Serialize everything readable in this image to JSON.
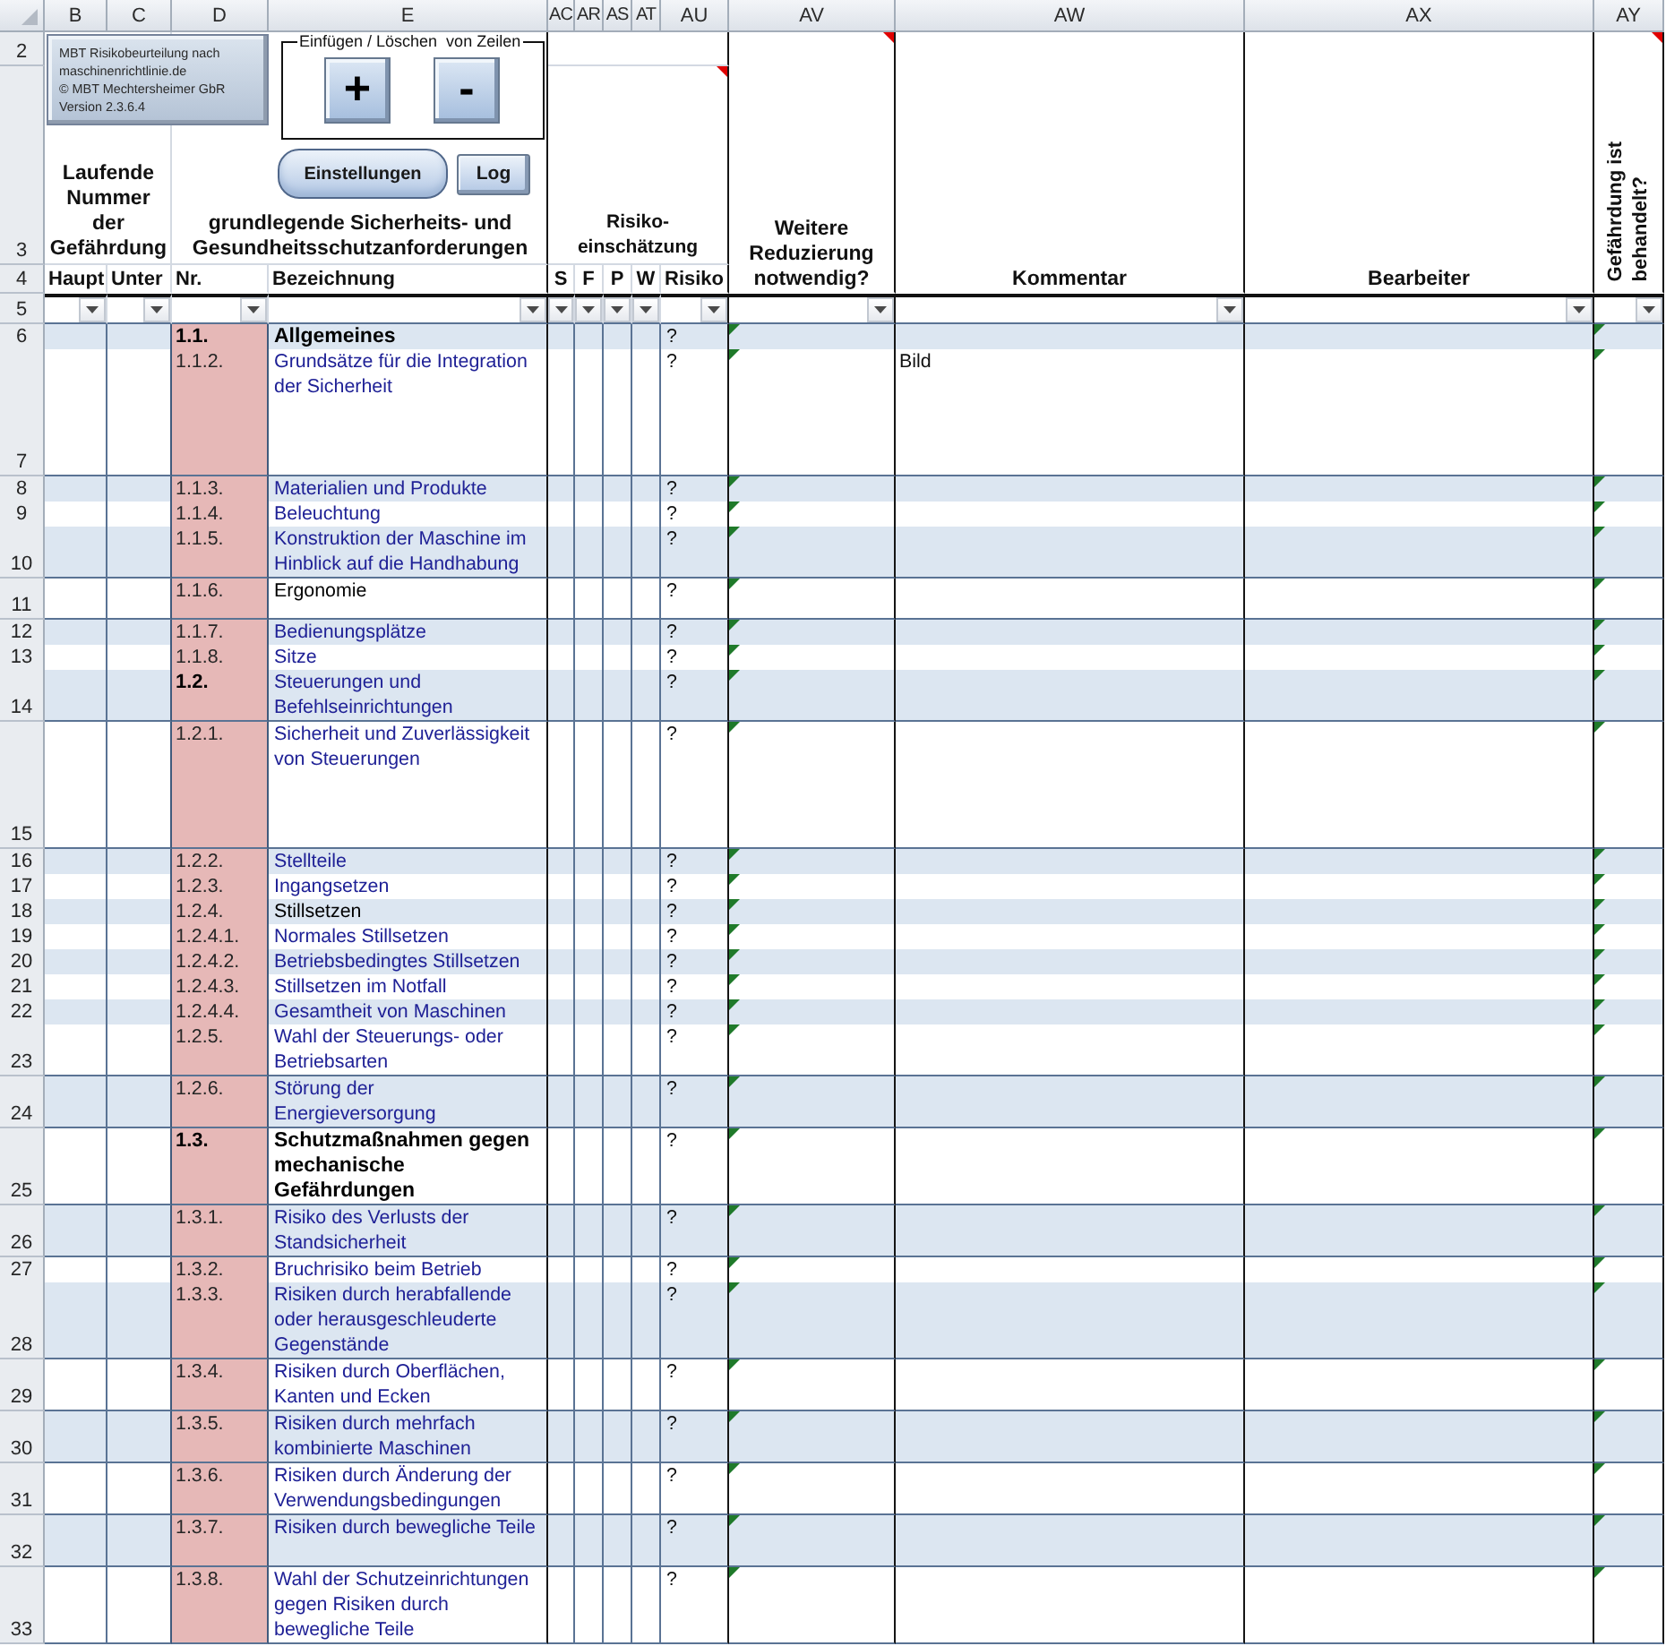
{
  "columns": [
    {
      "letter": "B",
      "filter": true
    },
    {
      "letter": "C",
      "filter": true
    },
    {
      "letter": "D",
      "filter": true
    },
    {
      "letter": "E",
      "filter": true
    },
    {
      "letter": "AC",
      "filter": true
    },
    {
      "letter": "AR",
      "filter": true
    },
    {
      "letter": "AS",
      "filter": true
    },
    {
      "letter": "AT",
      "filter": true
    },
    {
      "letter": "AU",
      "filter": true
    },
    {
      "letter": "AV",
      "filter": true
    },
    {
      "letter": "AW",
      "filter": true
    },
    {
      "letter": "AX",
      "filter": true
    },
    {
      "letter": "AY",
      "filter": true
    }
  ],
  "header_rows": [
    "2",
    "3",
    "4",
    "5"
  ],
  "info_box": {
    "text": "MBT Risikobeurteilung nach\nmaschinenrichtlinie.de\n© MBT Mechtersheimer GbR\nVersion 2.3.6.4"
  },
  "row_tools": {
    "label": "Einfügen / Löschen  von Zeilen",
    "buttons": [
      "+",
      "-"
    ]
  },
  "buttons": [
    {
      "label": "Einstellungen",
      "kind": "rounded"
    },
    {
      "label": "Log",
      "kind": "square"
    }
  ],
  "headings": {
    "hazard_number": {
      "text": "Laufende\nNummer\nder\nGefährdung"
    },
    "requirements": {
      "text": "grundlegende Sicherheits- und\nGesundheitsschutzanforderungen"
    },
    "risk_assessment": {
      "text": "Risiko-\neinschätzung",
      "comment": true
    },
    "further_reduction": {
      "text": "Weitere\nReduzierung\nnotwendig?",
      "comment": true
    },
    "remarks": {
      "text": "Kommentar"
    },
    "editor": {
      "text": "Bearbeiter"
    },
    "handled": {
      "text": "Gefährdung ist\nbehandelt?",
      "comment": true
    }
  },
  "subheadings": [
    "Haupt",
    "Unter",
    "Nr.",
    "Bezeichnung",
    "S",
    "F",
    "P",
    "W",
    "Risiko"
  ],
  "rows": [
    {
      "row": "6",
      "nr": "1.1.",
      "title": "Allgemeines",
      "kind": "section",
      "bold": true,
      "link": false,
      "risk": "?",
      "error_indicator": true
    },
    {
      "row": "7",
      "nr": "1.1.2.",
      "title": "Grundsätze für die Integration\nder Sicherheit",
      "kind": "item",
      "bold": false,
      "link": true,
      "risk": "?",
      "comment": "Bild",
      "error_indicator": true
    },
    {
      "row": "8",
      "nr": "1.1.3.",
      "title": "Materialien und Produkte",
      "kind": "item",
      "bold": false,
      "link": true,
      "risk": "?",
      "error_indicator": true
    },
    {
      "row": "9",
      "nr": "1.1.4.",
      "title": "Beleuchtung",
      "kind": "item",
      "bold": false,
      "link": true,
      "risk": "?",
      "error_indicator": true
    },
    {
      "row": "10",
      "nr": "1.1.5.",
      "title": "Konstruktion der Maschine im\nHinblick auf die Handhabung",
      "kind": "item",
      "bold": false,
      "link": true,
      "risk": "?",
      "error_indicator": true
    },
    {
      "row": "11",
      "nr": "1.1.6.",
      "title": "Ergonomie",
      "kind": "item",
      "bold": false,
      "link": false,
      "risk": "?",
      "error_indicator": true
    },
    {
      "row": "12",
      "nr": "1.1.7.",
      "title": "Bedienungsplätze",
      "kind": "item",
      "bold": false,
      "link": true,
      "risk": "?",
      "error_indicator": true
    },
    {
      "row": "13",
      "nr": "1.1.8.",
      "title": "Sitze",
      "kind": "item",
      "bold": false,
      "link": true,
      "risk": "?",
      "error_indicator": true
    },
    {
      "row": "14",
      "nr": "1.2.",
      "title": "Steuerungen und\nBefehlseinrichtungen",
      "kind": "section",
      "bold": false,
      "link": true,
      "risk": "?",
      "error_indicator": true
    },
    {
      "row": "15",
      "nr": "1.2.1.",
      "title": "Sicherheit und Zuverlässigkeit\nvon Steuerungen",
      "kind": "item",
      "bold": false,
      "link": true,
      "risk": "?",
      "error_indicator": true
    },
    {
      "row": "16",
      "nr": "1.2.2.",
      "title": "Stellteile",
      "kind": "item",
      "bold": false,
      "link": true,
      "risk": "?",
      "error_indicator": true
    },
    {
      "row": "17",
      "nr": "1.2.3.",
      "title": "Ingangsetzen",
      "kind": "item",
      "bold": false,
      "link": true,
      "risk": "?",
      "error_indicator": true
    },
    {
      "row": "18",
      "nr": "1.2.4.",
      "title": "Stillsetzen",
      "kind": "item",
      "bold": false,
      "link": false,
      "risk": "?",
      "error_indicator": true
    },
    {
      "row": "19",
      "nr": "1.2.4.1.",
      "title": "Normales Stillsetzen",
      "kind": "item",
      "bold": false,
      "link": true,
      "risk": "?",
      "error_indicator": true
    },
    {
      "row": "20",
      "nr": "1.2.4.2.",
      "title": "Betriebsbedingtes Stillsetzen",
      "kind": "item",
      "bold": false,
      "link": true,
      "risk": "?",
      "error_indicator": true
    },
    {
      "row": "21",
      "nr": "1.2.4.3.",
      "title": "Stillsetzen im Notfall",
      "kind": "item",
      "bold": false,
      "link": true,
      "risk": "?",
      "error_indicator": true
    },
    {
      "row": "22",
      "nr": "1.2.4.4.",
      "title": "Gesamtheit von Maschinen",
      "kind": "item",
      "bold": false,
      "link": true,
      "risk": "?",
      "error_indicator": true
    },
    {
      "row": "23",
      "nr": "1.2.5.",
      "title": "Wahl der Steuerungs- oder\nBetriebsarten",
      "kind": "item",
      "bold": false,
      "link": true,
      "risk": "?",
      "error_indicator": true
    },
    {
      "row": "24",
      "nr": "1.2.6.",
      "title": "Störung der\nEnergieversorgung",
      "kind": "item",
      "bold": false,
      "link": true,
      "risk": "?",
      "error_indicator": true
    },
    {
      "row": "25",
      "nr": "1.3.",
      "title": "Schutzmaßnahmen gegen\nmechanische\nGefährdungen",
      "kind": "section",
      "bold": true,
      "link": false,
      "risk": "?",
      "error_indicator": true
    },
    {
      "row": "26",
      "nr": "1.3.1.",
      "title": "Risiko des Verlusts der\nStandsicherheit",
      "kind": "item",
      "bold": false,
      "link": true,
      "risk": "?",
      "error_indicator": true
    },
    {
      "row": "27",
      "nr": "1.3.2.",
      "title": "Bruchrisiko beim Betrieb",
      "kind": "item",
      "bold": false,
      "link": true,
      "risk": "?",
      "error_indicator": true
    },
    {
      "row": "28",
      "nr": "1.3.3.",
      "title": "Risiken durch herabfallende\noder herausgeschleuderte\nGegenstände",
      "kind": "item",
      "bold": false,
      "link": true,
      "risk": "?",
      "error_indicator": true
    },
    {
      "row": "29",
      "nr": "1.3.4.",
      "title": "Risiken durch Oberflächen,\nKanten und Ecken",
      "kind": "item",
      "bold": false,
      "link": true,
      "risk": "?",
      "error_indicator": true
    },
    {
      "row": "30",
      "nr": "1.3.5.",
      "title": "Risiken durch mehrfach\nkombinierte Maschinen",
      "kind": "item",
      "bold": false,
      "link": true,
      "risk": "?",
      "error_indicator": true
    },
    {
      "row": "31",
      "nr": "1.3.6.",
      "title": "Risiken durch Änderung der\nVerwendungsbedingungen",
      "kind": "item",
      "bold": false,
      "link": true,
      "risk": "?",
      "error_indicator": true
    },
    {
      "row": "32",
      "nr": "1.3.7.",
      "title": "Risiken durch bewegliche Teile",
      "kind": "item",
      "bold": false,
      "link": true,
      "risk": "?",
      "error_indicator": true
    },
    {
      "row": "33",
      "nr": "1.3.8.",
      "title": "Wahl der Schutzeinrichtungen\ngegen Risiken durch\nbewegliche Teile",
      "kind": "item",
      "bold": false,
      "link": true,
      "risk": "?",
      "error_indicator": true
    }
  ]
}
